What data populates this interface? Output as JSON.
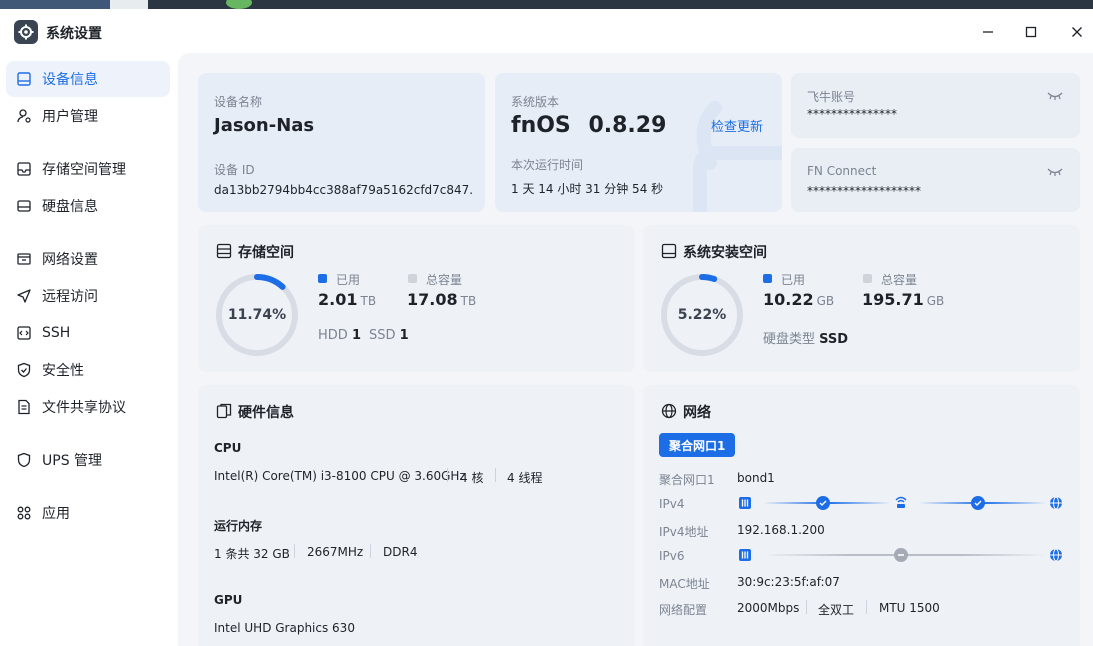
{
  "window": {
    "title": "系统设置"
  },
  "sidebar": {
    "items": [
      {
        "label": "设备信息"
      },
      {
        "label": "用户管理"
      },
      {
        "label": "存储空间管理"
      },
      {
        "label": "硬盘信息"
      },
      {
        "label": "网络设置"
      },
      {
        "label": "远程访问"
      },
      {
        "label": "SSH"
      },
      {
        "label": "安全性"
      },
      {
        "label": "文件共享协议"
      },
      {
        "label": "UPS 管理"
      },
      {
        "label": "应用"
      }
    ]
  },
  "device": {
    "name_label": "设备名称",
    "name": "Jason-Nas",
    "id_label": "设备 ID",
    "id": "da13bb2794bb4cc388af79a5162cfd7c847..."
  },
  "version": {
    "label": "系统版本",
    "os": "fnOS",
    "number": "0.8.29",
    "check_update": "检查更新",
    "uptime_label": "本次运行时间",
    "uptime": "1 天 14 小时 31 分钟 54 秒"
  },
  "accounts": {
    "feiniu_label": "飞牛账号",
    "feiniu_value": "***************",
    "fn_label": "FN Connect",
    "fn_value": "*******************"
  },
  "storage": {
    "title": "存储空间",
    "percent": "11.74%",
    "used_fraction": 0.1174,
    "used_label": "已用",
    "used_value": "2.01",
    "used_unit": "TB",
    "total_label": "总容量",
    "total_value": "17.08",
    "total_unit": "TB",
    "hdd_label": "HDD",
    "hdd_count": "1",
    "ssd_label": "SSD",
    "ssd_count": "1"
  },
  "system_space": {
    "title": "系统安装空间",
    "percent": "5.22%",
    "used_fraction": 0.0522,
    "used_label": "已用",
    "used_value": "10.22",
    "used_unit": "GB",
    "total_label": "总容量",
    "total_value": "195.71",
    "total_unit": "GB",
    "disk_type_label": "硬盘类型",
    "disk_type": "SSD"
  },
  "hardware": {
    "title": "硬件信息",
    "cpu_label": "CPU",
    "cpu_model": "Intel(R) Core(TM) i3-8100 CPU @ 3.60GHz",
    "cpu_cores": "4 核",
    "cpu_threads": "4 线程",
    "mem_label": "运行内存",
    "mem_count": "1 条共 32 GB",
    "mem_speed": "2667MHz",
    "mem_type": "DDR4",
    "gpu_label": "GPU",
    "gpu_model": "Intel UHD Graphics 630"
  },
  "network": {
    "title": "网络",
    "tab": "聚合网口1",
    "iface_label": "聚合网口1",
    "iface_value": "bond1",
    "ipv4_label": "IPv4",
    "ipv4_addr_label": "IPv4地址",
    "ipv4_addr": "192.168.1.200",
    "ipv6_label": "IPv6",
    "mac_label": "MAC地址",
    "mac": "30:9c:23:5f:af:07",
    "config_label": "网络配置",
    "speed": "2000Mbps",
    "duplex": "全双工",
    "mtu": "MTU 1500"
  },
  "colors": {
    "accent": "#1d6ee6",
    "ring_track": "#d8dde5",
    "legend_total": "#cfd4db"
  }
}
